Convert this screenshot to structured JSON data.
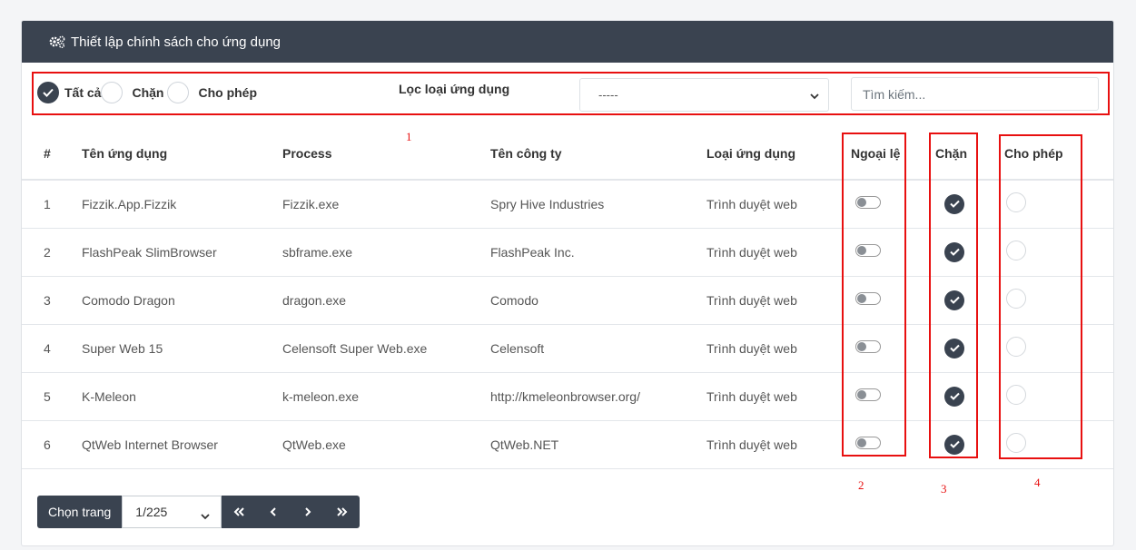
{
  "header": {
    "title": "Thiết lập chính sách cho ứng dụng",
    "icon": "gears-icon"
  },
  "filter": {
    "radios": [
      {
        "label": "Tất cả",
        "checked": true
      },
      {
        "label": "Chặn",
        "checked": false
      },
      {
        "label": "Cho phép",
        "checked": false
      }
    ],
    "type_label": "Lọc loại ứng dụng",
    "type_select_value": "-----",
    "search_placeholder": "Tìm kiếm..."
  },
  "table": {
    "columns": [
      "#",
      "Tên ứng dụng",
      "Process",
      "Tên công ty",
      "Loại ứng dụng",
      "Ngoại lệ",
      "Chặn",
      "Cho phép"
    ],
    "rows": [
      {
        "no": "1",
        "name": "Fizzik.App.Fizzik",
        "process": "Fizzik.exe",
        "company": "Spry Hive Industries",
        "type": "Trình duyệt web",
        "exception": false,
        "block": true,
        "allow": false
      },
      {
        "no": "2",
        "name": "FlashPeak SlimBrowser",
        "process": "sbframe.exe",
        "company": "FlashPeak Inc.",
        "type": "Trình duyệt web",
        "exception": false,
        "block": true,
        "allow": false
      },
      {
        "no": "3",
        "name": "Comodo Dragon",
        "process": "dragon.exe",
        "company": "Comodo",
        "type": "Trình duyệt web",
        "exception": false,
        "block": true,
        "allow": false
      },
      {
        "no": "4",
        "name": "Super Web 15",
        "process": "Celensoft Super Web.exe",
        "company": "Celensoft",
        "type": "Trình duyệt web",
        "exception": false,
        "block": true,
        "allow": false
      },
      {
        "no": "5",
        "name": "K-Meleon",
        "process": "k-meleon.exe",
        "company": "http://kmeleonbrowser.org/",
        "type": "Trình duyệt web",
        "exception": false,
        "block": true,
        "allow": false
      },
      {
        "no": "6",
        "name": "QtWeb Internet Browser",
        "process": "QtWeb.exe",
        "company": "QtWeb.NET",
        "type": "Trình duyệt web",
        "exception": false,
        "block": true,
        "allow": false
      }
    ]
  },
  "pagination": {
    "label": "Chọn trang",
    "current": "1/225",
    "buttons": [
      "«",
      "‹",
      "›",
      "»"
    ]
  },
  "annotations": [
    "1",
    "2",
    "3",
    "4"
  ],
  "colors": {
    "header_bg": "#3a4350",
    "annotation": "#e81010"
  }
}
